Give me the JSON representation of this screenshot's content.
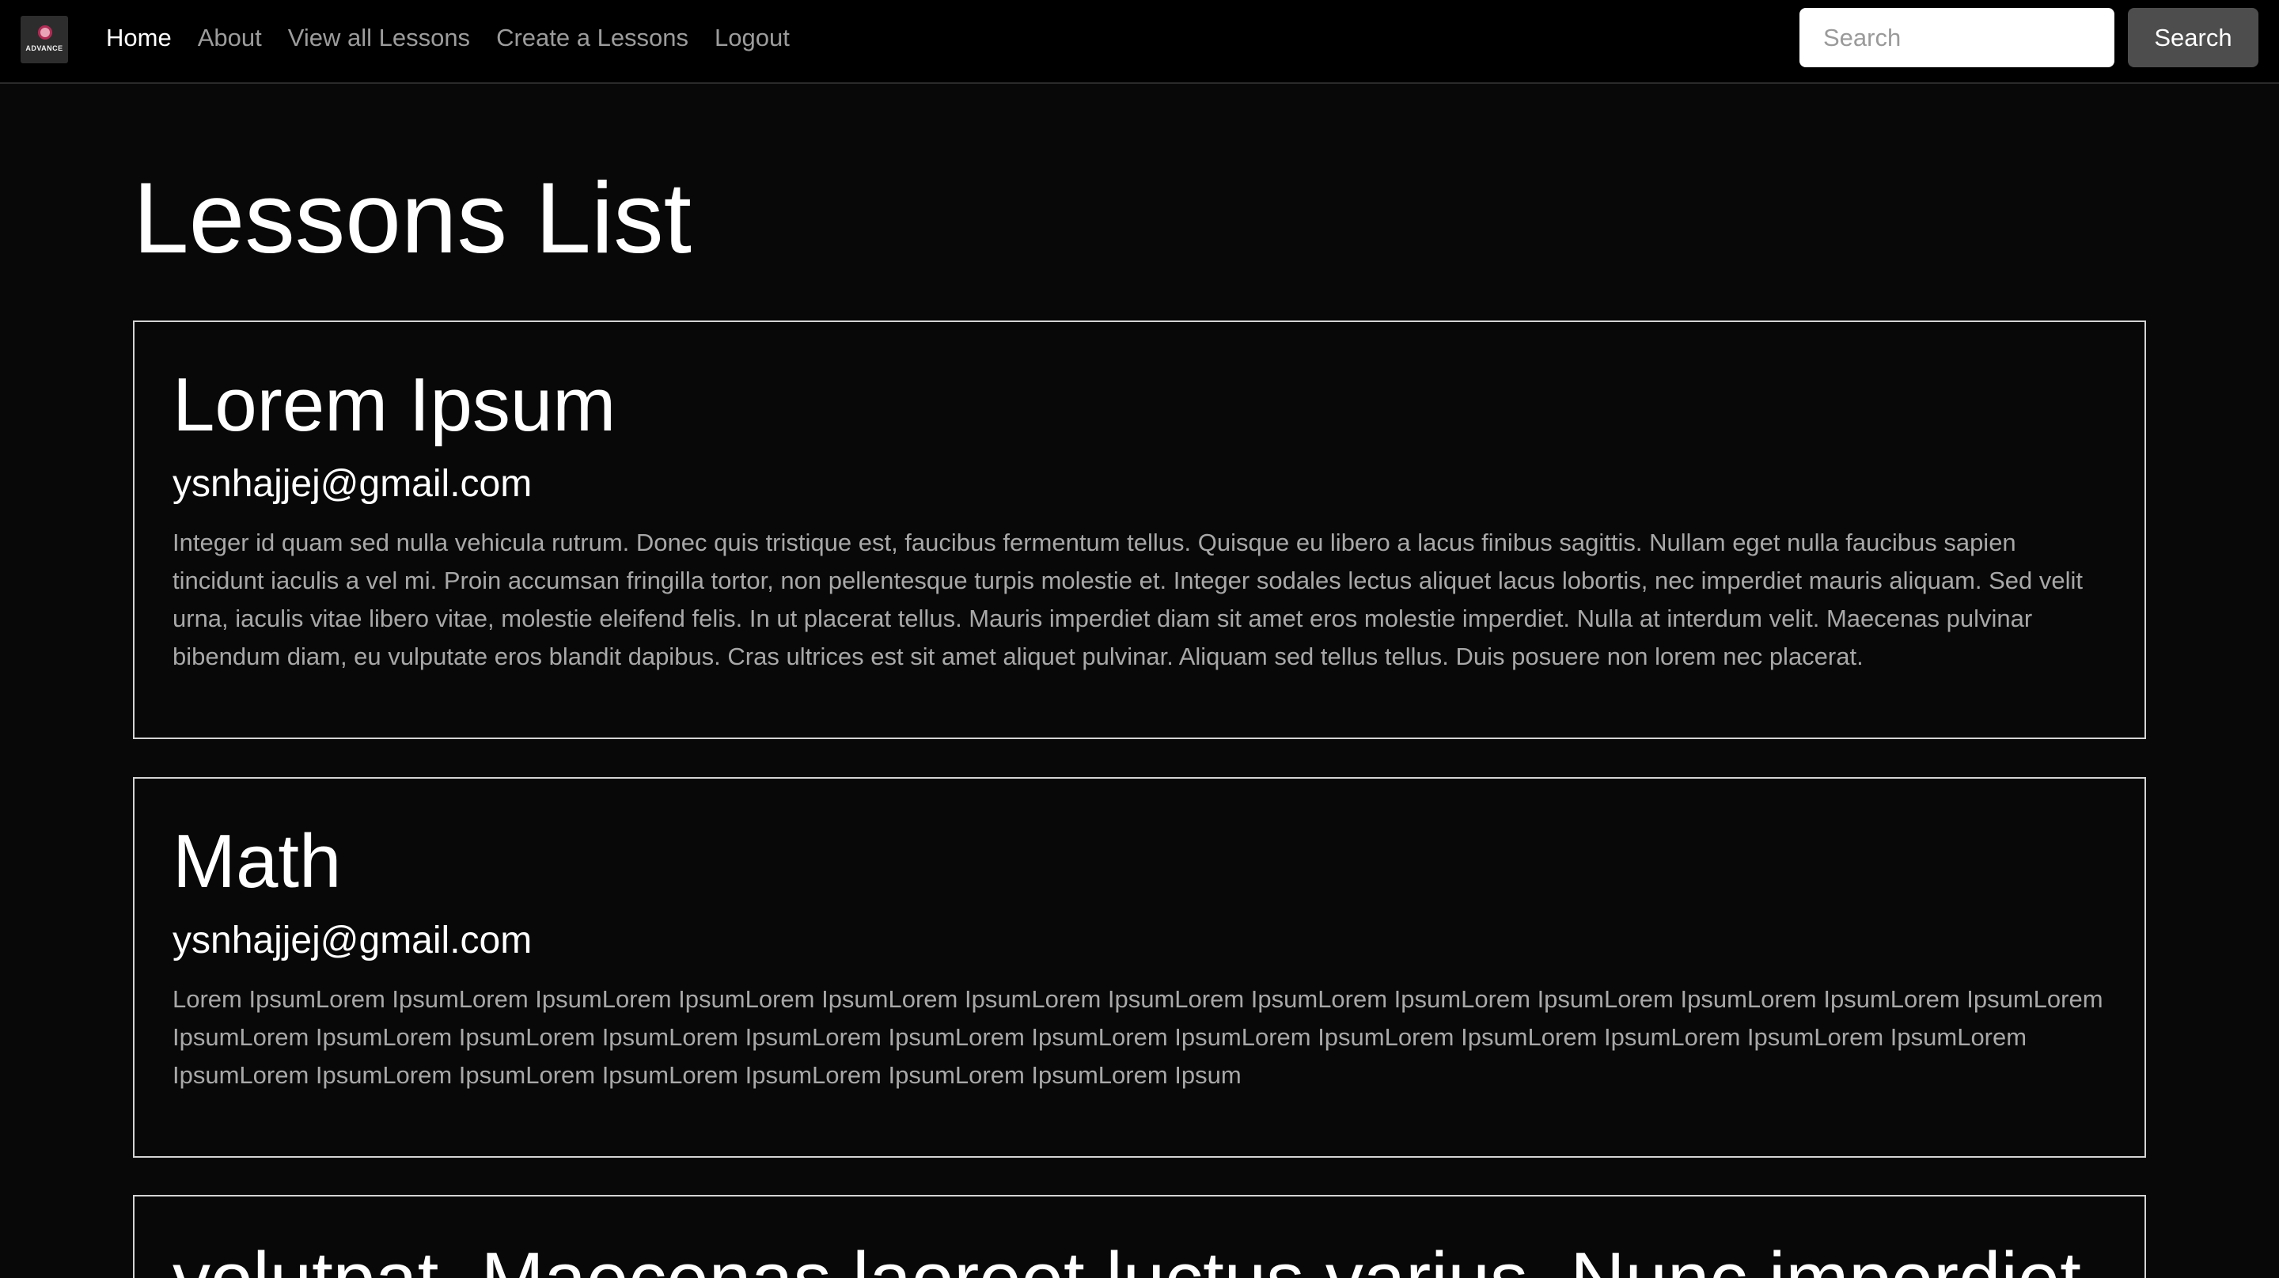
{
  "nav": {
    "brand_text": "ADVANCE",
    "links": [
      {
        "label": "Home",
        "active": true
      },
      {
        "label": "About",
        "active": false
      },
      {
        "label": "View all Lessons",
        "active": false
      },
      {
        "label": "Create a Lessons",
        "active": false
      },
      {
        "label": "Logout",
        "active": false
      }
    ],
    "search_placeholder": "Search",
    "search_button": "Search"
  },
  "page": {
    "title": "Lessons List"
  },
  "lessons": [
    {
      "title": "Lorem Ipsum",
      "email": "ysnhajjej@gmail.com",
      "body": "Integer id quam sed nulla vehicula rutrum. Donec quis tristique est, faucibus fermentum tellus. Quisque eu libero a lacus finibus sagittis. Nullam eget nulla faucibus sapien tincidunt iaculis a vel mi. Proin accumsan fringilla tortor, non pellentesque turpis molestie et. Integer sodales lectus aliquet lacus lobortis, nec imperdiet mauris aliquam. Sed velit urna, iaculis vitae libero vitae, molestie eleifend felis. In ut placerat tellus. Mauris imperdiet diam sit amet eros molestie imperdiet. Nulla at interdum velit. Maecenas pulvinar bibendum diam, eu vulputate eros blandit dapibus. Cras ultrices est sit amet aliquet pulvinar. Aliquam sed tellus tellus. Duis posuere non lorem nec placerat."
    },
    {
      "title": "Math",
      "email": "ysnhajjej@gmail.com",
      "body": "Lorem IpsumLorem IpsumLorem IpsumLorem IpsumLorem IpsumLorem IpsumLorem IpsumLorem IpsumLorem IpsumLorem IpsumLorem IpsumLorem IpsumLorem IpsumLorem IpsumLorem IpsumLorem IpsumLorem IpsumLorem IpsumLorem IpsumLorem IpsumLorem IpsumLorem IpsumLorem IpsumLorem IpsumLorem IpsumLorem IpsumLorem IpsumLorem IpsumLorem IpsumLorem IpsumLorem IpsumLorem IpsumLorem IpsumLorem Ipsum"
    },
    {
      "title": "volutpat. Maecenas laoreet luctus varius. Nunc imperdiet"
    }
  ],
  "colors": {
    "background": "#080808",
    "navbar": "#000000",
    "card_border": "#d4d4d4",
    "body_text": "#a8a8a8",
    "nav_link": "#9c9c9c",
    "search_button": "#4d4d4d"
  }
}
